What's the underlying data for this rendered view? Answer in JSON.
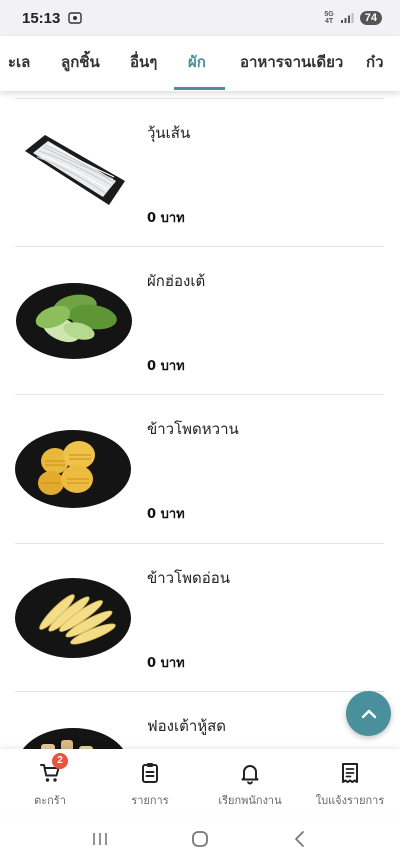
{
  "status_bar": {
    "time": "15:13",
    "network_top": "5G",
    "network_bottom": "4T",
    "battery": "74"
  },
  "tabs": [
    {
      "label": "ะเล",
      "active": false
    },
    {
      "label": "ลูกชิ้น",
      "active": false
    },
    {
      "label": "อื่นๆ",
      "active": false
    },
    {
      "label": "ผัก",
      "active": true
    },
    {
      "label": "อาหารจานเดียว",
      "active": false
    },
    {
      "label": "ก๋ว",
      "active": false
    }
  ],
  "menu_items": [
    {
      "name": "วุ้นเส้น",
      "price": "0 บาท",
      "image": "glass-noodles"
    },
    {
      "name": "ผักฮ่องเต้",
      "price": "0 บาท",
      "image": "bok-choy"
    },
    {
      "name": "ข้าวโพดหวาน",
      "price": "0 บาท",
      "image": "sweet-corn"
    },
    {
      "name": "ข้าวโพดอ่อน",
      "price": "0 บาท",
      "image": "baby-corn"
    },
    {
      "name": "ฟองเต้าหู้สด",
      "price": "",
      "image": "tofu-skin"
    }
  ],
  "bottom_nav": {
    "cart": {
      "label": "ตะกร้า",
      "badge": "2",
      "icon": "cart-icon"
    },
    "orders": {
      "label": "รายการ",
      "icon": "clipboard-icon"
    },
    "call_staff": {
      "label": "เรียกพนักงาน",
      "icon": "bell-icon"
    },
    "receipt": {
      "label": "ใบแจ้งรายการ",
      "icon": "receipt-icon"
    }
  },
  "colors": {
    "accent": "#4a8f9c",
    "badge": "#e9533f",
    "status_bar_bg": "#f1f1f6"
  }
}
